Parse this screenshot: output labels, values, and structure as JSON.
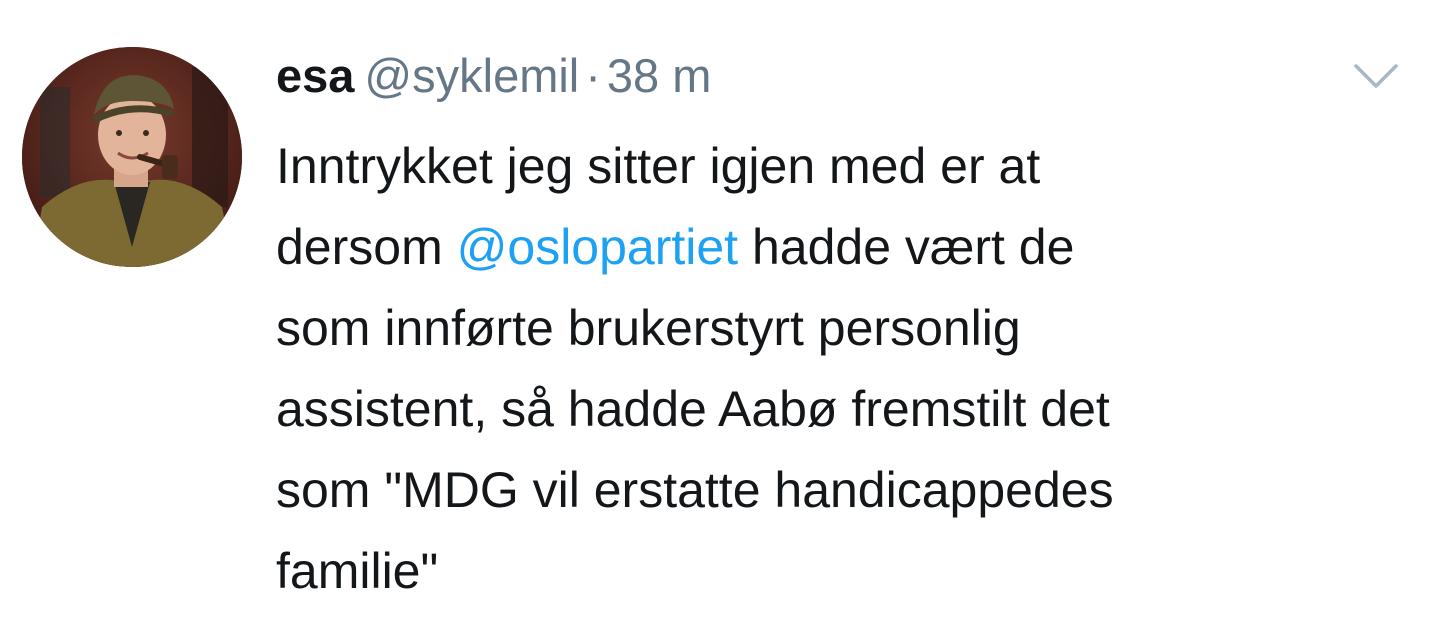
{
  "author": {
    "display_name": "esa",
    "handle": "@syklemil",
    "separator": "·",
    "timestamp": "38 m"
  },
  "menu": {
    "icon": "chevron-down-icon"
  },
  "tweet": {
    "lines": [
      {
        "text": "Inntrykket jeg sitter igjen med er at"
      },
      {
        "before": "dersom ",
        "mention": "@oslopartiet",
        "after": " hadde vært de"
      },
      {
        "text": "som innførte brukerstyrt personlig"
      },
      {
        "text": "assistent, så hadde Aabø fremstilt det"
      },
      {
        "text": "som \"MDG vil erstatte handicappedes"
      },
      {
        "text": "familie\""
      }
    ]
  },
  "colors": {
    "text": "#14171a",
    "secondary": "#657786",
    "mention": "#1da1f2",
    "caret": "#aab8c2"
  }
}
